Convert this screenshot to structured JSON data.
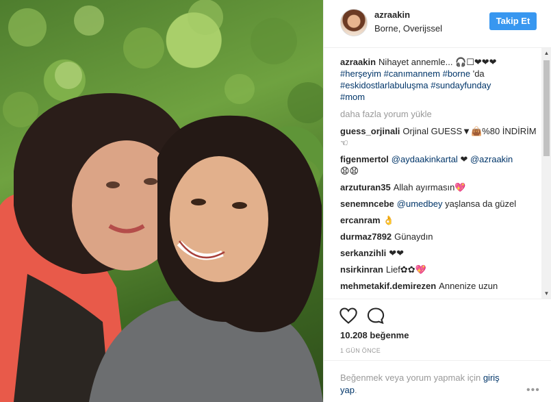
{
  "header": {
    "username": "azraakin",
    "location": "Borne, Overijssel",
    "follow_label": "Takip Et"
  },
  "caption": {
    "username": "azraakin",
    "text": "Nihayet annemle... 🎧☐❤❤❤",
    "line2_tags": [
      "#herşeyim",
      "#canımannem",
      "#borne"
    ],
    "line2_suffix": "'da",
    "line3_tags": [
      "#eskidostlarlabuluşma",
      "#sundayfunday"
    ],
    "line4_tags": [
      "#mom"
    ]
  },
  "load_more_label": "daha fazla yorum yükle",
  "comments": [
    {
      "user": "guess_orjinali",
      "text": "Orjinal GUESS▼👜%80 İNDİRİM ☜"
    },
    {
      "user": "figenmertol",
      "mention1": "@aydaakinkartal",
      "mid": " ❤ ",
      "mention2": "@azraakin",
      "text": "😧😧"
    },
    {
      "user": "arzuturan35",
      "text": "Allah ayırmasın💖"
    },
    {
      "user": "senemncebe",
      "mention1": "@umedbey",
      "text": "yaşlansa da güzel"
    },
    {
      "user": "ercanram",
      "text": "👌"
    },
    {
      "user": "durmaz7892",
      "text": "Günaydın"
    },
    {
      "user": "serkanzihli",
      "text": "❤❤"
    },
    {
      "user": "nsirkinran",
      "text": "Lief✿✿💖"
    },
    {
      "user": "mehmetakif.demirezen",
      "text": "Annenize uzun"
    }
  ],
  "likes_label": "10.208 beğenme",
  "time_label": "1 GÜN ÖNCE",
  "login": {
    "prefix": "Beğenmek veya yorum yapmak için",
    "link": "giriş yap",
    "suffix": ".",
    "more": "•••"
  },
  "colors": {
    "accent": "#3897f0",
    "link": "#003569",
    "muted": "#999999"
  }
}
